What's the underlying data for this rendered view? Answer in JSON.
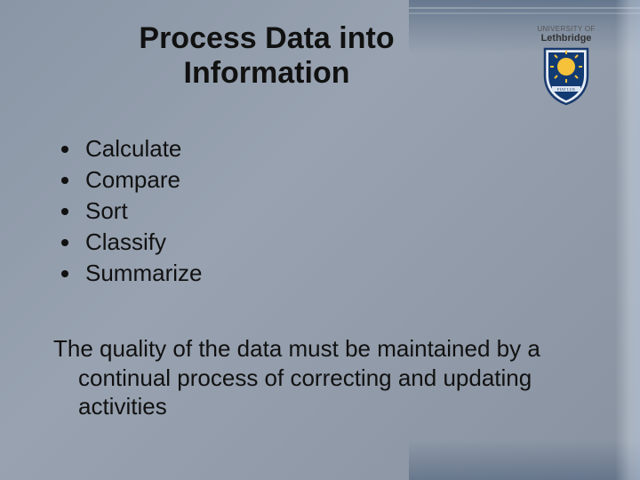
{
  "title_line1": "Process Data into",
  "title_line2": "Information",
  "bullets": {
    "item0": "Calculate",
    "item1": "Compare",
    "item2": "Sort",
    "item3": "Classify",
    "item4": "Summarize"
  },
  "paragraph": "The quality of the data must be maintained by a continual process of correcting and updating activities",
  "logo": {
    "prefix": "UNIVERSITY OF",
    "name": "Lethbridge",
    "motto": "FIAT LUX"
  }
}
